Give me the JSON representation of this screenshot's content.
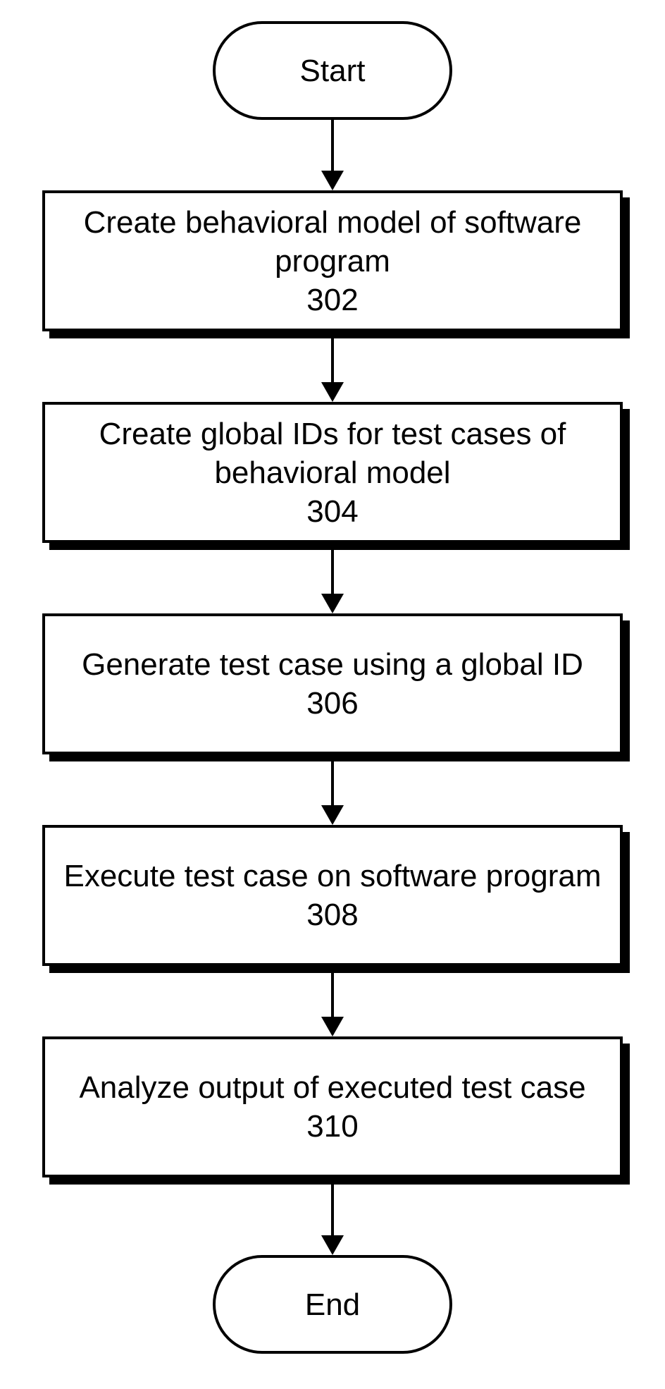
{
  "chart_data": {
    "type": "flowchart",
    "nodes": [
      {
        "id": "start",
        "kind": "terminator",
        "label": "Start"
      },
      {
        "id": "302",
        "kind": "process",
        "label": "Create behavioral model of software program",
        "num": "302"
      },
      {
        "id": "304",
        "kind": "process",
        "label": "Create global IDs for test cases of behavioral model",
        "num": "304"
      },
      {
        "id": "306",
        "kind": "process",
        "label": "Generate test case using a global ID",
        "num": "306"
      },
      {
        "id": "308",
        "kind": "process",
        "label": "Execute test case on software program",
        "num": "308"
      },
      {
        "id": "310",
        "kind": "process",
        "label": "Analyze output of executed test case",
        "num": "310"
      },
      {
        "id": "end",
        "kind": "terminator",
        "label": "End"
      }
    ],
    "edges": [
      [
        "start",
        "302"
      ],
      [
        "302",
        "304"
      ],
      [
        "304",
        "306"
      ],
      [
        "306",
        "308"
      ],
      [
        "308",
        "310"
      ],
      [
        "310",
        "end"
      ]
    ]
  },
  "start": {
    "label": "Start"
  },
  "end": {
    "label": "End"
  },
  "steps": [
    {
      "label": "Create behavioral model of software program",
      "num": "302"
    },
    {
      "label": "Create global IDs for test cases of behavioral model",
      "num": "304"
    },
    {
      "label": "Generate test case using a global ID",
      "num": "306"
    },
    {
      "label": "Execute test case on software program",
      "num": "308"
    },
    {
      "label": "Analyze output of executed test case",
      "num": "310"
    }
  ]
}
